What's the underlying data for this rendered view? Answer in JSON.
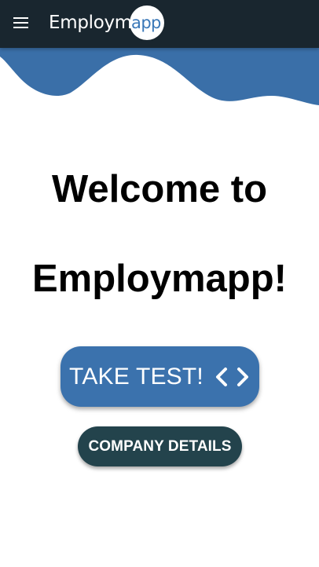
{
  "header": {
    "logo": {
      "text_main": "Employm",
      "text_circle": "app"
    },
    "menu_icon": "hamburger-menu-icon"
  },
  "welcome": {
    "line1": "Welcome to",
    "line2": "Employmapp!"
  },
  "buttons": {
    "take_test": {
      "label": "TAKE TEST!",
      "icon": "code-icon"
    },
    "company_details": {
      "label": "COMPANY DETAILS"
    }
  },
  "colors": {
    "header_bg": "#19262f",
    "wave": "#3a6fa8",
    "take_test_bg": "#3b72ad",
    "company_bg": "#23434c",
    "logo_accent": "#3a78b8"
  }
}
